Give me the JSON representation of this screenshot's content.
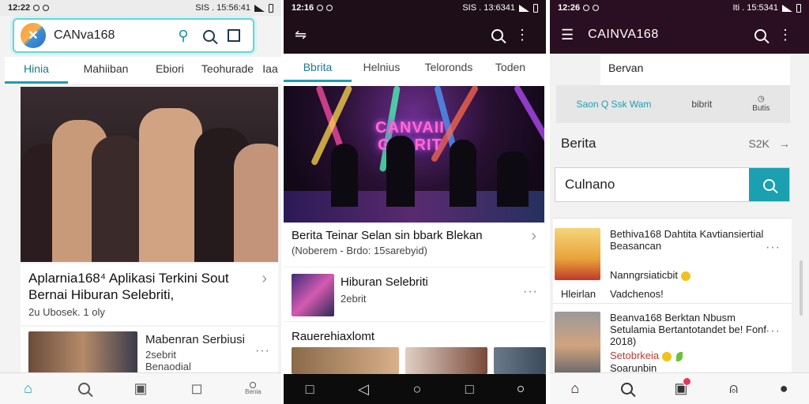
{
  "screen1": {
    "status": {
      "time": "12:22",
      "right": "SIS . 15:56:41"
    },
    "app_title": "CANva168",
    "tabs": [
      "Hinia",
      "Mahiiban",
      "Ebiori",
      "Teohurade",
      "Iaa"
    ],
    "active_tab": 0,
    "headline": {
      "title": "Aplarnia168⁴ Aplikasi Terkini Sout Bernai Hiburan Selebriti,",
      "meta": "2u Ubosek. 1 oly"
    },
    "item": {
      "title": "Mabenran Serbiusi",
      "sub1": "2sebrit",
      "sub2": "Benaodial"
    },
    "nav": [
      "home-icon",
      "search-icon",
      "apps-icon",
      "chat-icon",
      "profile-icon"
    ],
    "nav_last_label": "Benia"
  },
  "screen2": {
    "status": {
      "time": "12:16",
      "right": "SIS . 13:6341"
    },
    "tabs": [
      "Bbrita",
      "Helnius",
      "Teloronds",
      "Toden"
    ],
    "active_tab": 0,
    "neon_text": "CANVAII GEBRIT",
    "headline": {
      "title": "Berita Teinar Selan sin bbark Blekan",
      "meta": "(Noberem - Brdo: 15sarebyid)"
    },
    "item": {
      "title": "Hiburan Selebriti",
      "sub": "2ebrit"
    },
    "section": "Rauerehiaxlomt"
  },
  "screen3": {
    "status": {
      "time": "12:26",
      "right": "Iti . 15:5341"
    },
    "app_title": "CAINVA168",
    "berita_top": "Bervan",
    "categories": [
      {
        "label": "Saon Q Ssk Wam"
      },
      {
        "label": "bibrit"
      },
      {
        "label": "Butis"
      }
    ],
    "berita_header": "Berita",
    "berita_count": "S2K",
    "search_value": "Culnano",
    "items": [
      {
        "title": "Bethiva168 Dahtita Kavtiansiertial Beasancan",
        "sub": "Nanngrsiaticbit",
        "meta1": "Hleirlan",
        "meta2": "Vadchenos!"
      },
      {
        "title": "Beanva168 Berktan Nbusm Setulamia Bertantotandet be! Fonf 2018)",
        "sub": "Setobrkeia",
        "meta1": "Soarunbin"
      }
    ]
  }
}
